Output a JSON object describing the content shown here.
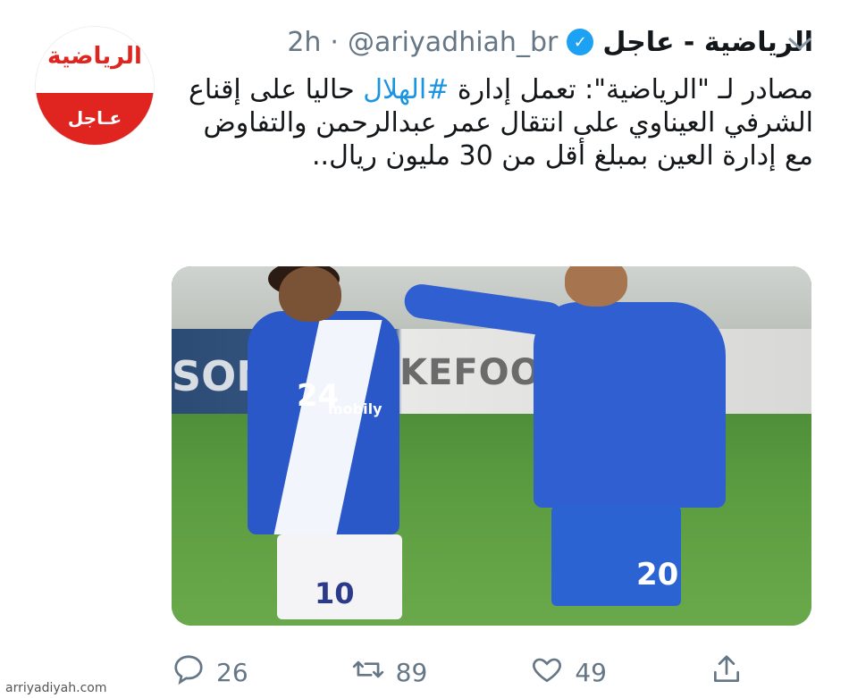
{
  "account": {
    "display_name": "الرياضية - عاجل",
    "handle": "@ariyadhiah_br",
    "separator": "·",
    "time": "2h",
    "avatar": {
      "logo_text": "الرياضية",
      "badge_text": "عـاجل"
    }
  },
  "tweet": {
    "text_before": "مصادر لـ \"الرياضية\": تعمل إدارة ",
    "hashtag": "#الهلال",
    "text_after": " حاليا على إقناع الشرفي العيناوي على انتقال عمر عبدالرحمن والتفاوض مع إدارة العين بمبلغ أقل من 30 مليون ريال.."
  },
  "media": {
    "board_text": "KEFOOT",
    "board_text_left": "SON",
    "jersey_numbers": [
      "24",
      "20"
    ],
    "shorts_number": "10",
    "sponsor": "mobily"
  },
  "actions": {
    "reply_count": "26",
    "retweet_count": "89",
    "like_count": "49"
  },
  "watermark": "arriyadiyah.com",
  "colors": {
    "accent": "#1da1f2",
    "hashtag": "#1b95e0",
    "brand_red": "#e0241f",
    "muted": "#657786"
  },
  "icons": [
    "verified-icon",
    "chevron-down-icon",
    "reply-icon",
    "retweet-icon",
    "like-icon",
    "share-icon"
  ]
}
